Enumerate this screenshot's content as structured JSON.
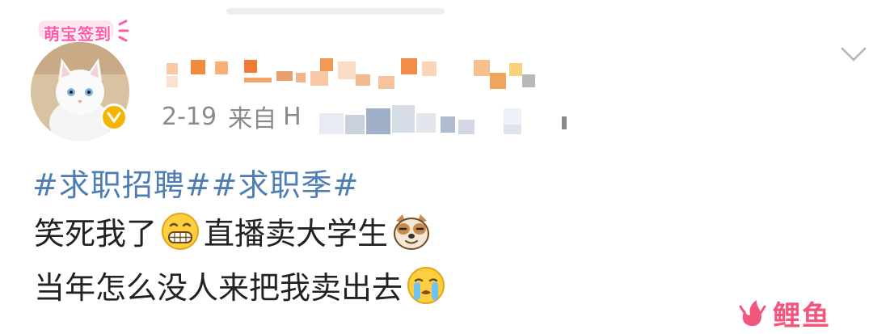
{
  "badge": {
    "text": "萌宝签到"
  },
  "post": {
    "date": "2-19",
    "from_label": "来自",
    "device_prefix": "H",
    "hashtags": "#求职招聘##求职季#",
    "line1_a": "笑死我了",
    "line1_b": "直播卖大学生",
    "line2": "当年怎么没人来把我卖出去"
  },
  "icons": {
    "verified": "verified-v-badge-icon",
    "menu": "chevron-down-icon",
    "emoji1": "grin-emoji-icon",
    "emoji2": "doge-emoji-icon",
    "emoji3": "crying-emoji-icon"
  },
  "watermark": {
    "text": "鲤鱼",
    "color": "#f2567c"
  },
  "colors": {
    "hashtag": "#4e7db4",
    "verified": "#f4b400",
    "badge": "#ff5aa8"
  }
}
